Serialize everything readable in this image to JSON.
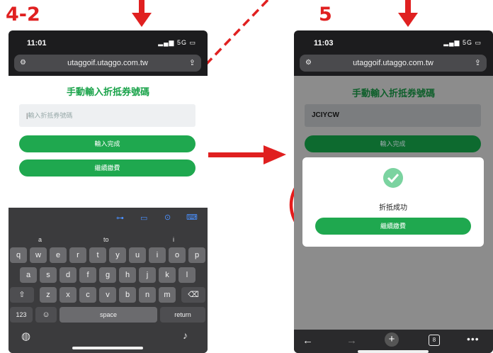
{
  "steps": {
    "left": "4-2",
    "right": "5"
  },
  "colors": {
    "annotation_red": "#e02020",
    "brand_green": "#1fa84f",
    "dark_green": "#0d6a2f"
  },
  "left_phone": {
    "status_time": "11:01",
    "status_signal": "5G",
    "url": "utaggoif.utaggo.com.tw",
    "page_title": "手動輸入折抵券號碼",
    "input_placeholder": "輸入折抵券號碼",
    "btn_done": "輸入完成",
    "btn_continue": "繼續繳費",
    "keyboard": {
      "suggestions": [
        "a",
        "to",
        "i"
      ],
      "row1": [
        "q",
        "w",
        "e",
        "r",
        "t",
        "y",
        "u",
        "i",
        "o",
        "p"
      ],
      "row2": [
        "a",
        "s",
        "d",
        "f",
        "g",
        "h",
        "j",
        "k",
        "l"
      ],
      "row3": [
        "z",
        "x",
        "c",
        "v",
        "b",
        "n",
        "m"
      ],
      "num_key": "123",
      "space_key": "space",
      "return_key": "return"
    }
  },
  "right_phone": {
    "status_time": "11:03",
    "status_signal": "5G",
    "url": "utaggoif.utaggo.com.tw",
    "page_title": "手動輸入折抵券號碼",
    "input_value": "JCIYCW",
    "btn_done": "輸入完成",
    "modal_message": "折抵成功",
    "modal_button": "繼續繳費",
    "tabs_count": "8"
  },
  "icons": [
    "shift-icon",
    "backspace-icon",
    "emoji-icon",
    "globe-icon",
    "mic-icon",
    "key-icon",
    "card-icon",
    "location-icon",
    "back-arrow-icon",
    "forward-arrow-icon",
    "new-tab-icon",
    "tabs-icon",
    "more-icon",
    "check-icon"
  ]
}
